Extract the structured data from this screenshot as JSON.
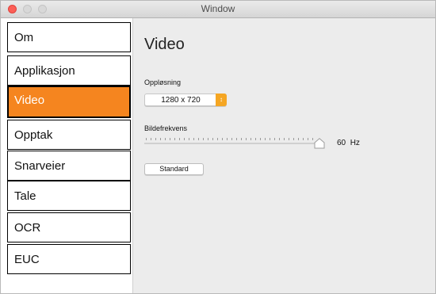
{
  "window": {
    "title": "Window"
  },
  "sidebar": {
    "items": [
      {
        "label": "Om",
        "selected": false
      },
      {
        "label": "Applikasjon",
        "selected": false
      },
      {
        "label": "Video",
        "selected": true
      },
      {
        "label": "Opptak",
        "selected": false
      },
      {
        "label": "Snarveier",
        "selected": false
      },
      {
        "label": "Tale",
        "selected": false
      },
      {
        "label": "OCR",
        "selected": false
      },
      {
        "label": "EUC",
        "selected": false
      }
    ]
  },
  "main": {
    "title": "Video",
    "resolution": {
      "label": "Oppløsning",
      "value": "1280 x 720"
    },
    "framerate": {
      "label": "Bildefrekvens",
      "value": 60,
      "value_text": "60",
      "unit": "Hz"
    },
    "standard_button": "Standard"
  },
  "colors": {
    "accent": "#f5851f",
    "popup_accent": "#f5a623"
  }
}
